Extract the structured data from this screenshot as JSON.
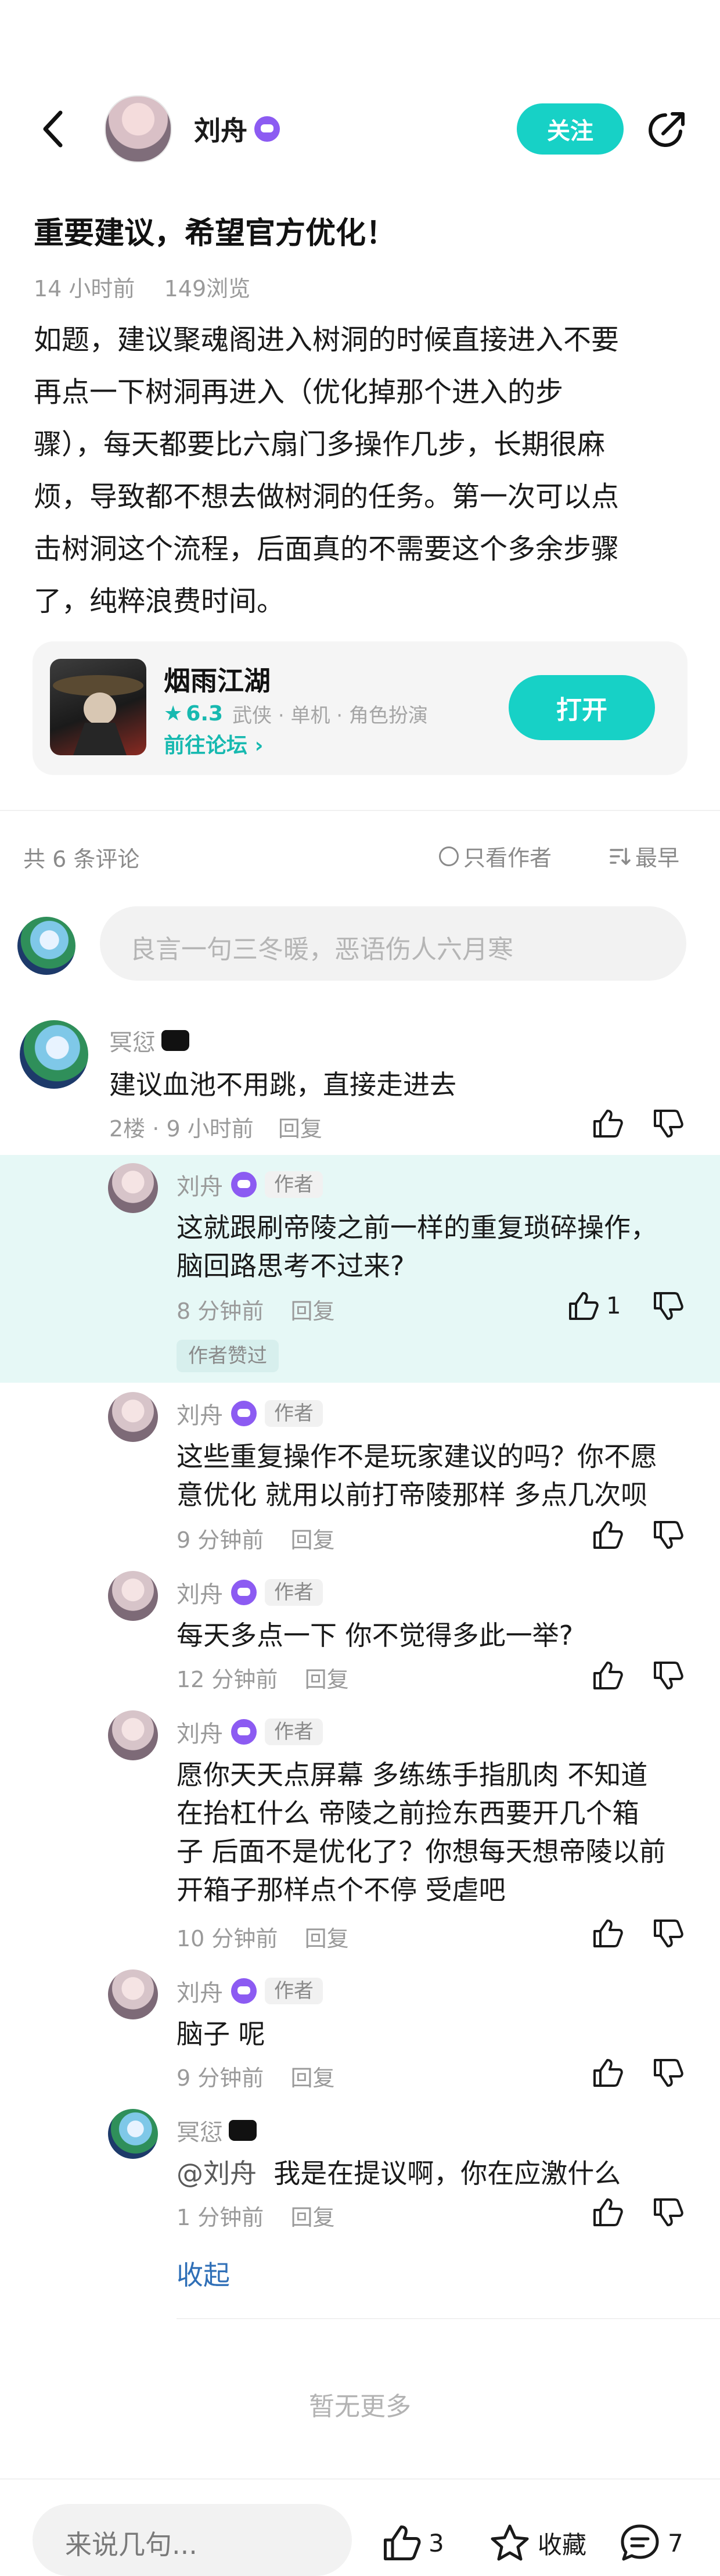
{
  "header": {
    "author_name": "刘舟",
    "follow_label": "关注"
  },
  "post": {
    "title": "重要建议，希望官方优化！",
    "time": "14 小时前",
    "views": "149浏览",
    "body_lines": [
      "如题，建议聚魂阁进入树洞的时候直接进入不要",
      "再点一下树洞再进入（优化掉那个进入的步",
      "骤），每天都要比六扇门多操作几步，长期很麻",
      "烦，导致都不想去做树洞的任务。第一次可以点",
      "击树洞这个流程，后面真的不需要这个多余步骤",
      "了，纯粹浪费时间。"
    ]
  },
  "game_card": {
    "name": "烟雨江湖",
    "rating": "6.3",
    "tags": "武侠 · 单机 · 角色扮演",
    "forum_link": "前往论坛",
    "open_label": "打开"
  },
  "comments_bar": {
    "count": "共 6 条评论",
    "only_author": "只看作者",
    "sort": "最早"
  },
  "input": {
    "placeholder": "良言一句三冬暖，恶语伤人六月寒"
  },
  "comment": {
    "user": "冥愆",
    "text": "建议血池不用跳，直接走进去",
    "floor": "2楼",
    "time": "9 小时前",
    "reply": "回复"
  },
  "replies": [
    {
      "user": "刘舟",
      "tag": "作者",
      "lines": [
        "这就跟刷帝陵之前一样的重复琐碎操作，",
        "脑回路思考不过来?"
      ],
      "time": "8 分钟前",
      "reply": "回复",
      "likes": "1",
      "liked_by_author": "作者赞过"
    },
    {
      "user": "刘舟",
      "tag": "作者",
      "lines": [
        "这些重复操作不是玩家建议的吗？你不愿",
        "意优化 就用以前打帝陵那样 多点几次呗"
      ],
      "time": "9 分钟前",
      "reply": "回复"
    },
    {
      "user": "刘舟",
      "tag": "作者",
      "lines": [
        "每天多点一下 你不觉得多此一举?"
      ],
      "time": "12 分钟前",
      "reply": "回复"
    },
    {
      "user": "刘舟",
      "tag": "作者",
      "lines": [
        "愿你天天点屏幕 多练练手指肌肉 不知道",
        "在抬杠什么  帝陵之前捡东西要开几个箱",
        "子 后面不是优化了？你想每天想帝陵以前",
        "开箱子那样点个不停 受虐吧"
      ],
      "time": "10 分钟前",
      "reply": "回复"
    },
    {
      "user": "刘舟",
      "tag": "作者",
      "lines": [
        "脑子 呢"
      ],
      "time": "9 分钟前",
      "reply": "回复"
    },
    {
      "user": "冥愆",
      "mention": "@刘舟",
      "lines": [
        "我是在提议啊，你在应激什么"
      ],
      "time": "1 分钟前",
      "reply": "回复"
    }
  ],
  "collapse_label": "收起",
  "no_more": "暂无更多",
  "bottom_bar": {
    "placeholder": "来说几句...",
    "likes": "3",
    "collect": "收藏",
    "comments": "7"
  },
  "colors": {
    "accent": "#17d1c6",
    "highlight_bg": "#e6f8f6",
    "link": "#2f6fb7",
    "badge": "#8c5bf2"
  }
}
